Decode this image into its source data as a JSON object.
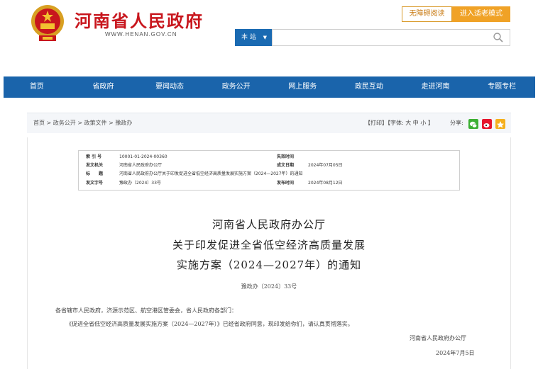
{
  "header": {
    "site_title": "河南省人民政府",
    "site_url": "WWW.HENAN.GOV.CN",
    "btn_accessible": "无障碍阅读",
    "btn_elder": "进入适老模式",
    "search_scope": "本 站",
    "search_placeholder": ""
  },
  "nav": [
    "首页",
    "省政府",
    "要闻动态",
    "政务公开",
    "网上服务",
    "政民互动",
    "走进河南",
    "专题专栏"
  ],
  "breadcrumb": {
    "text": "首页 > 政务公开 > 政策文件 > 豫政办",
    "tools": "【打印】【字体:  大  中  小 】",
    "share_label": "分享:",
    "share_icons": [
      "wechat-icon",
      "weibo-icon",
      "qzone-icon"
    ],
    "share_colors": [
      "#3cb034",
      "#e6162d",
      "#f5b01e"
    ]
  },
  "meta": {
    "index_key": "索 引 号",
    "index_val": "10001-01-2024-00360",
    "expire_key": "失效时间",
    "expire_val": "",
    "issuer_key": "发文机关",
    "issuer_val": "河南省人民政府办公厅",
    "date_key": "成文日期",
    "date_val": "2024年07月05日",
    "title_key": "标　　题",
    "title_val": "河南省人民政府办公厅关于印发促进全省低空经济高质量发展实施方案（2024—2027年）的通知",
    "docno_key": "发文字号",
    "docno_val": "豫政办〔2024〕33号",
    "pub_key": "发布时间",
    "pub_val": "2024年08月12日"
  },
  "document": {
    "title_line1": "河南省人民政府办公厅",
    "title_line2": "关于印发促进全省低空经济高质量发展",
    "title_line3": "实施方案（2024—2027年）的通知",
    "doc_number": "豫政办〔2024〕33号",
    "salutation": "各省辖市人民政府，济源示范区、航空港区管委会，省人民政府各部门：",
    "paragraph": "《促进全省低空经济高质量发展实施方案（2024—2027年）》已经省政府同意，现印发给你们，请认真贯彻落实。",
    "signature": "河南省人民政府办公厅",
    "sign_date": "2024年7月5日"
  }
}
